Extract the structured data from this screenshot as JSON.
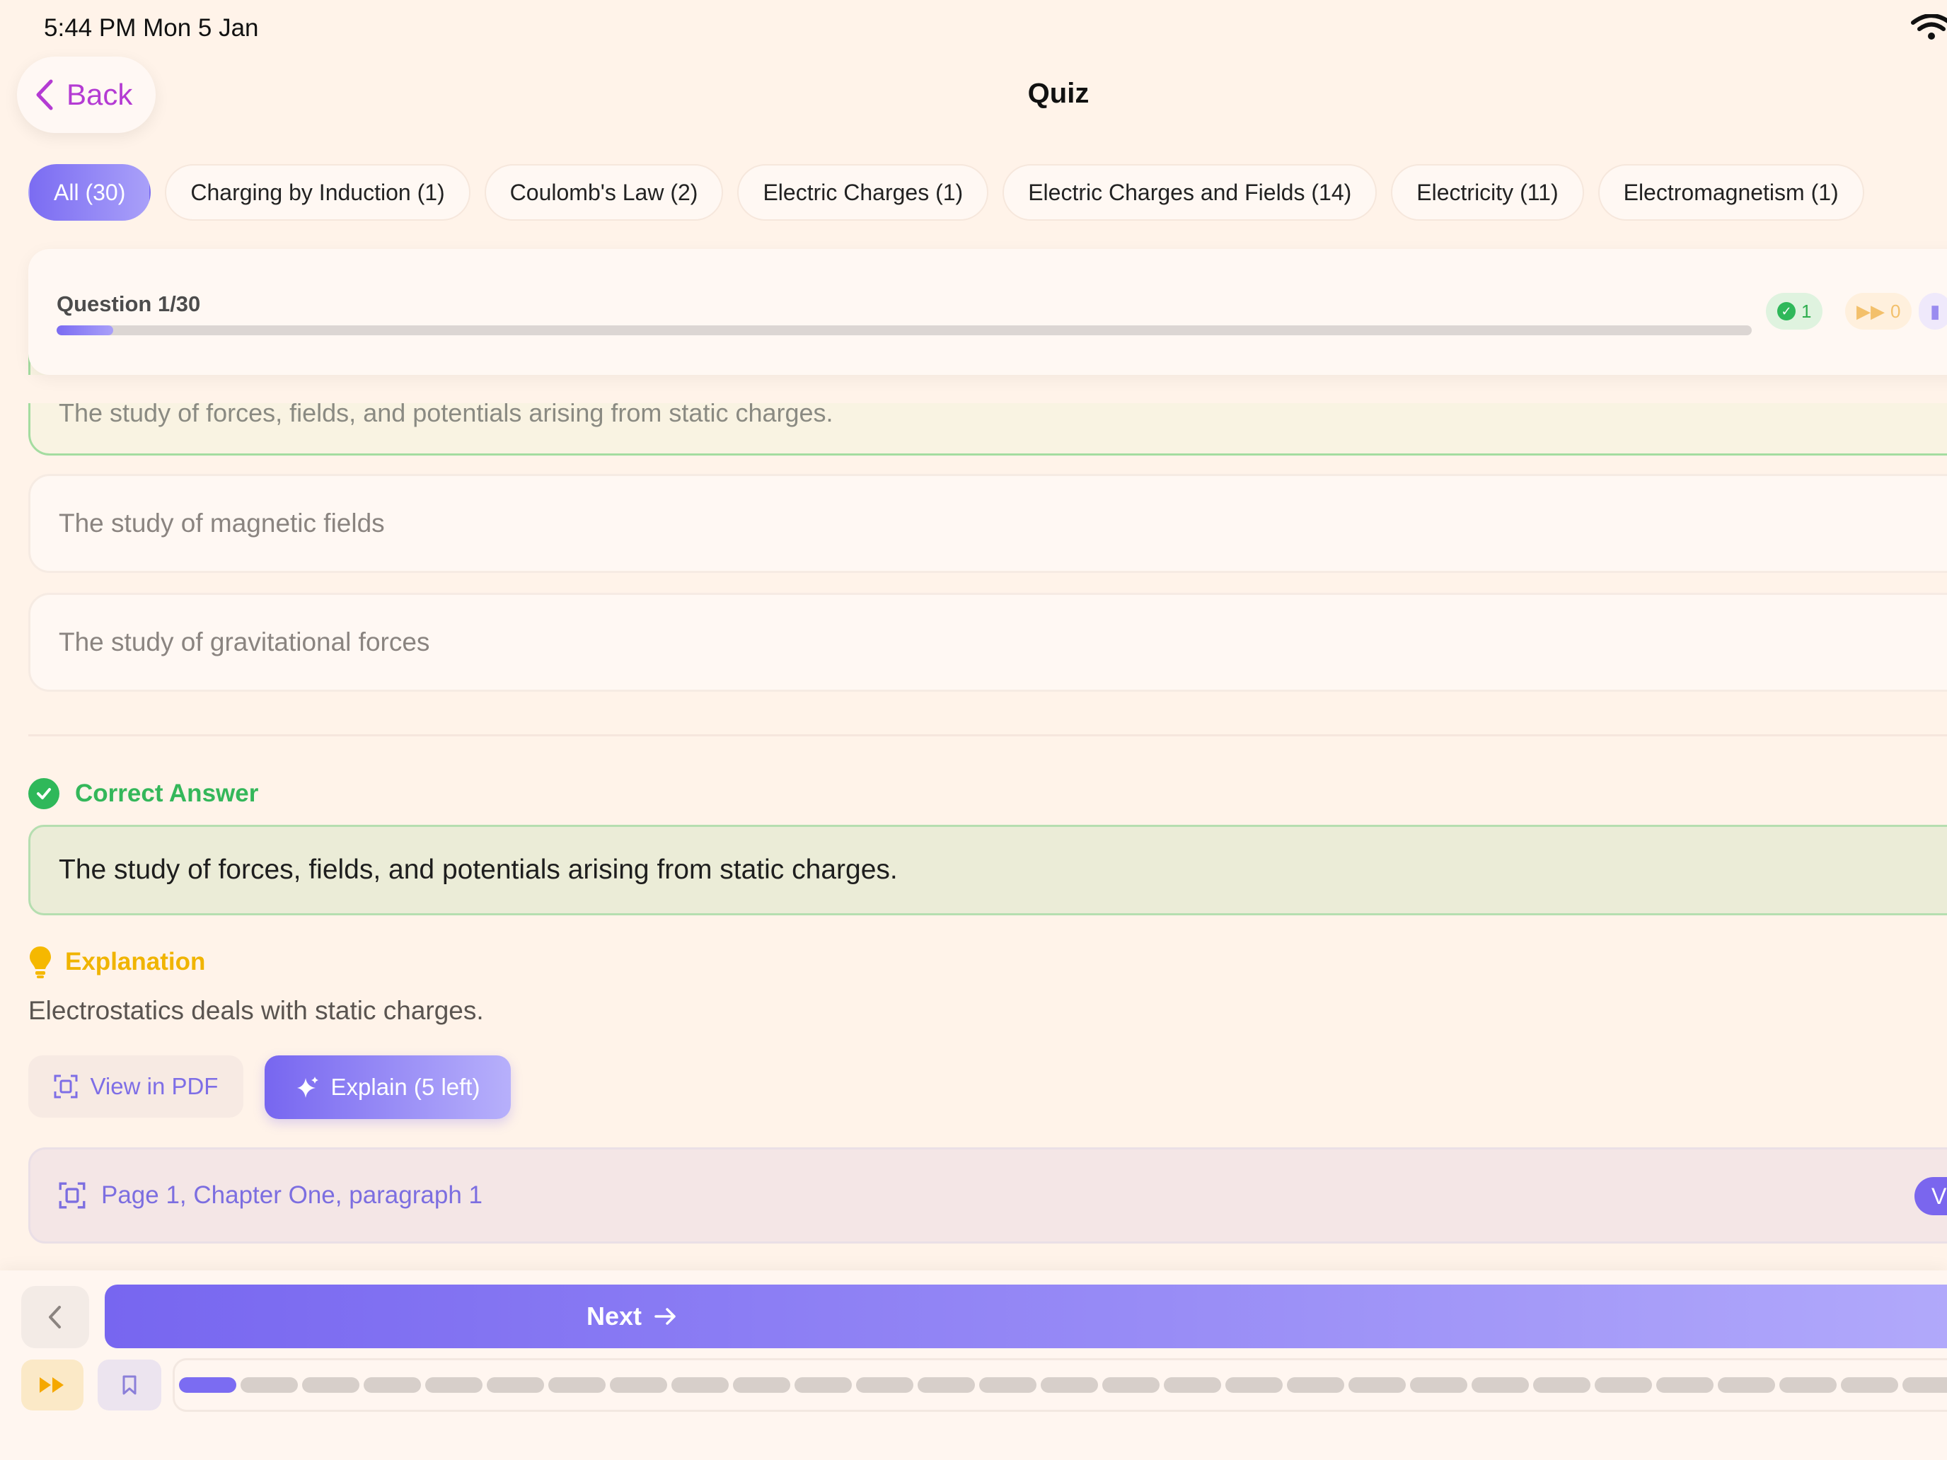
{
  "status_bar": {
    "time": "5:44 PM   Mon 5 Jan"
  },
  "header": {
    "back_label": "Back",
    "title": "Quiz"
  },
  "chips": [
    {
      "label": "All (30)",
      "active": true
    },
    {
      "label": "Charging by Induction (1)",
      "active": false
    },
    {
      "label": "Coulomb's Law (2)",
      "active": false
    },
    {
      "label": "Electric Charges (1)",
      "active": false
    },
    {
      "label": "Electric Charges and Fields (14)",
      "active": false
    },
    {
      "label": "Electricity (11)",
      "active": false
    },
    {
      "label": "Electromagnetism (1)",
      "active": false
    }
  ],
  "progress": {
    "question_label": "Question 1/30",
    "current": 1,
    "total": 30,
    "correct_count": "1",
    "skipped_count": "0"
  },
  "options": [
    {
      "text": "The study of forces, fields, and potentials arising from static charges.",
      "state": "correct-selected"
    },
    {
      "text": "The study of magnetic fields",
      "state": "default"
    },
    {
      "text": "The study of gravitational forces",
      "state": "default"
    }
  ],
  "correct_answer": {
    "label": "Correct Answer",
    "text": "The study of forces, fields, and potentials arising from static charges."
  },
  "explanation": {
    "label": "Explanation",
    "text": "Electrostatics deals with static charges."
  },
  "actions": {
    "view_pdf_label": "View in PDF",
    "explain_label": "Explain (5 left)"
  },
  "source": {
    "reference": "Page 1, Chapter One, paragraph 1",
    "view_label": "Vi"
  },
  "navigation": {
    "next_label": "Next"
  },
  "colors": {
    "accent": "#7b6cf2",
    "correct": "#2fb85a",
    "explanation": "#f0b400",
    "background": "#fff3e9"
  },
  "icons": {
    "back": "chevron-left-icon",
    "correct": "check-circle-icon",
    "explanation": "lightbulb-icon",
    "pdf": "document-scan-icon",
    "explain": "sparkle-icon",
    "next": "arrow-right-icon",
    "skip": "fast-forward-icon",
    "bookmark": "bookmark-icon"
  }
}
